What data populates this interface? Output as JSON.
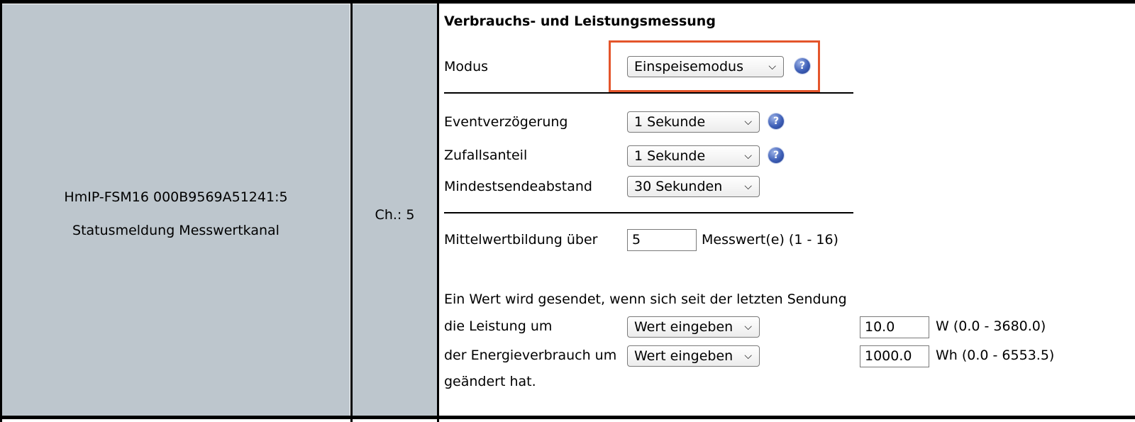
{
  "device": {
    "name": "HmIP-FSM16 000B9569A51241:5",
    "type": "Statusmeldung Messwertkanal"
  },
  "channel": {
    "label": "Ch.: 5"
  },
  "params": {
    "heading": "Verbrauchs- und Leistungsmessung",
    "mode": {
      "label": "Modus",
      "value": "Einspeisemodus"
    },
    "event_delay": {
      "label": "Eventverzögerung",
      "value": "1 Sekunde"
    },
    "random_part": {
      "label": "Zufallsanteil",
      "value": "1 Sekunde"
    },
    "min_send_interval": {
      "label": "Mindestsendeabstand",
      "value": "30 Sekunden"
    },
    "averaging": {
      "label": "Mittelwertbildung über",
      "value": "5",
      "unit": "Messwert(e) (1 - 16)"
    },
    "send_condition_text": "Ein Wert wird gesendet, wenn sich seit der letzten Sendung",
    "power_change": {
      "label": "die Leistung um",
      "mode": "Wert eingeben",
      "value": "10.0",
      "unit": "W (0.0 - 3680.0)"
    },
    "energy_change": {
      "label": "der Energieverbrauch um",
      "mode": "Wert eingeben",
      "value": "1000.0",
      "unit": "Wh (0.0 - 6553.5)"
    },
    "closing_text": "geändert hat."
  },
  "icons": {
    "help": "help-icon",
    "dropdown": "chevron-down-icon"
  },
  "colors": {
    "cell_background": "#bdc6cd",
    "highlight": "#e4552b",
    "help_icon": "#3e5fb7"
  }
}
